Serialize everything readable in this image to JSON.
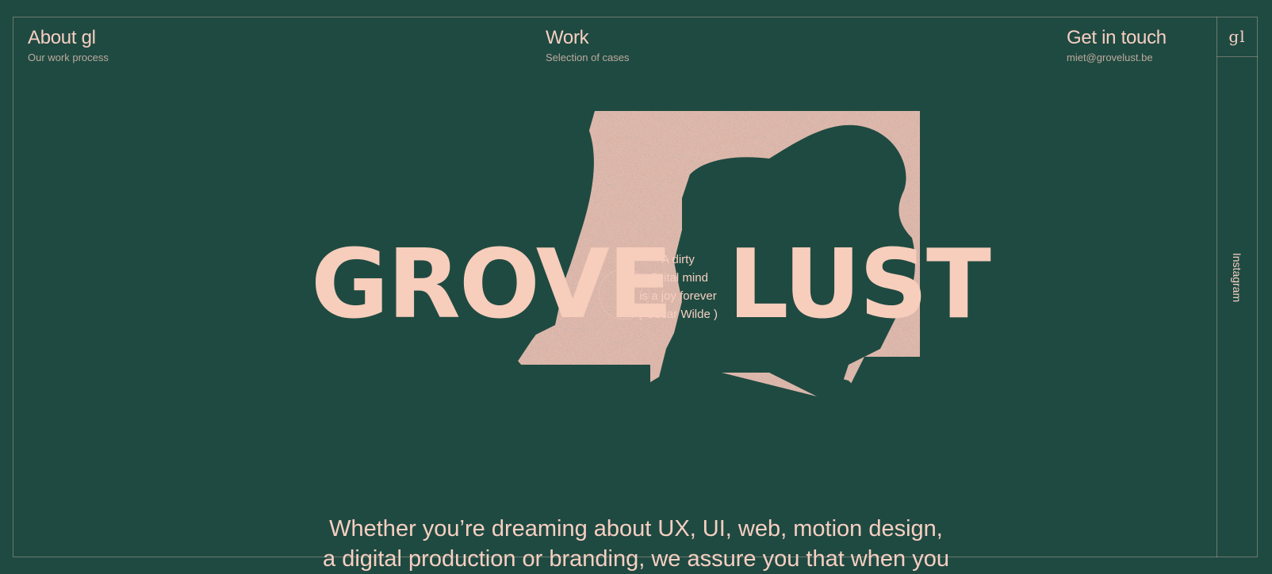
{
  "nav": {
    "about": {
      "title": "About gl",
      "subtitle": "Our work process"
    },
    "work": {
      "title": "Work",
      "subtitle": "Selection of cases"
    },
    "contact": {
      "title": "Get in touch",
      "subtitle": "miet@grovelust.be"
    }
  },
  "sidebar": {
    "logo": "gl",
    "instagram_label": "Instagram"
  },
  "hero": {
    "word_left": "GROVE",
    "word_right": "LUST",
    "quote_lines": [
      "A dirty",
      "digital mind",
      "is a joy forever",
      "( Oscar Wilde )"
    ]
  },
  "tagline": {
    "line1": "Whether you’re dreaming about UX, UI, web, motion design,",
    "line2": "a digital production or branding, we assure you that when you"
  },
  "colors": {
    "background": "#1f4a41",
    "accent": "#f6cfc2"
  }
}
